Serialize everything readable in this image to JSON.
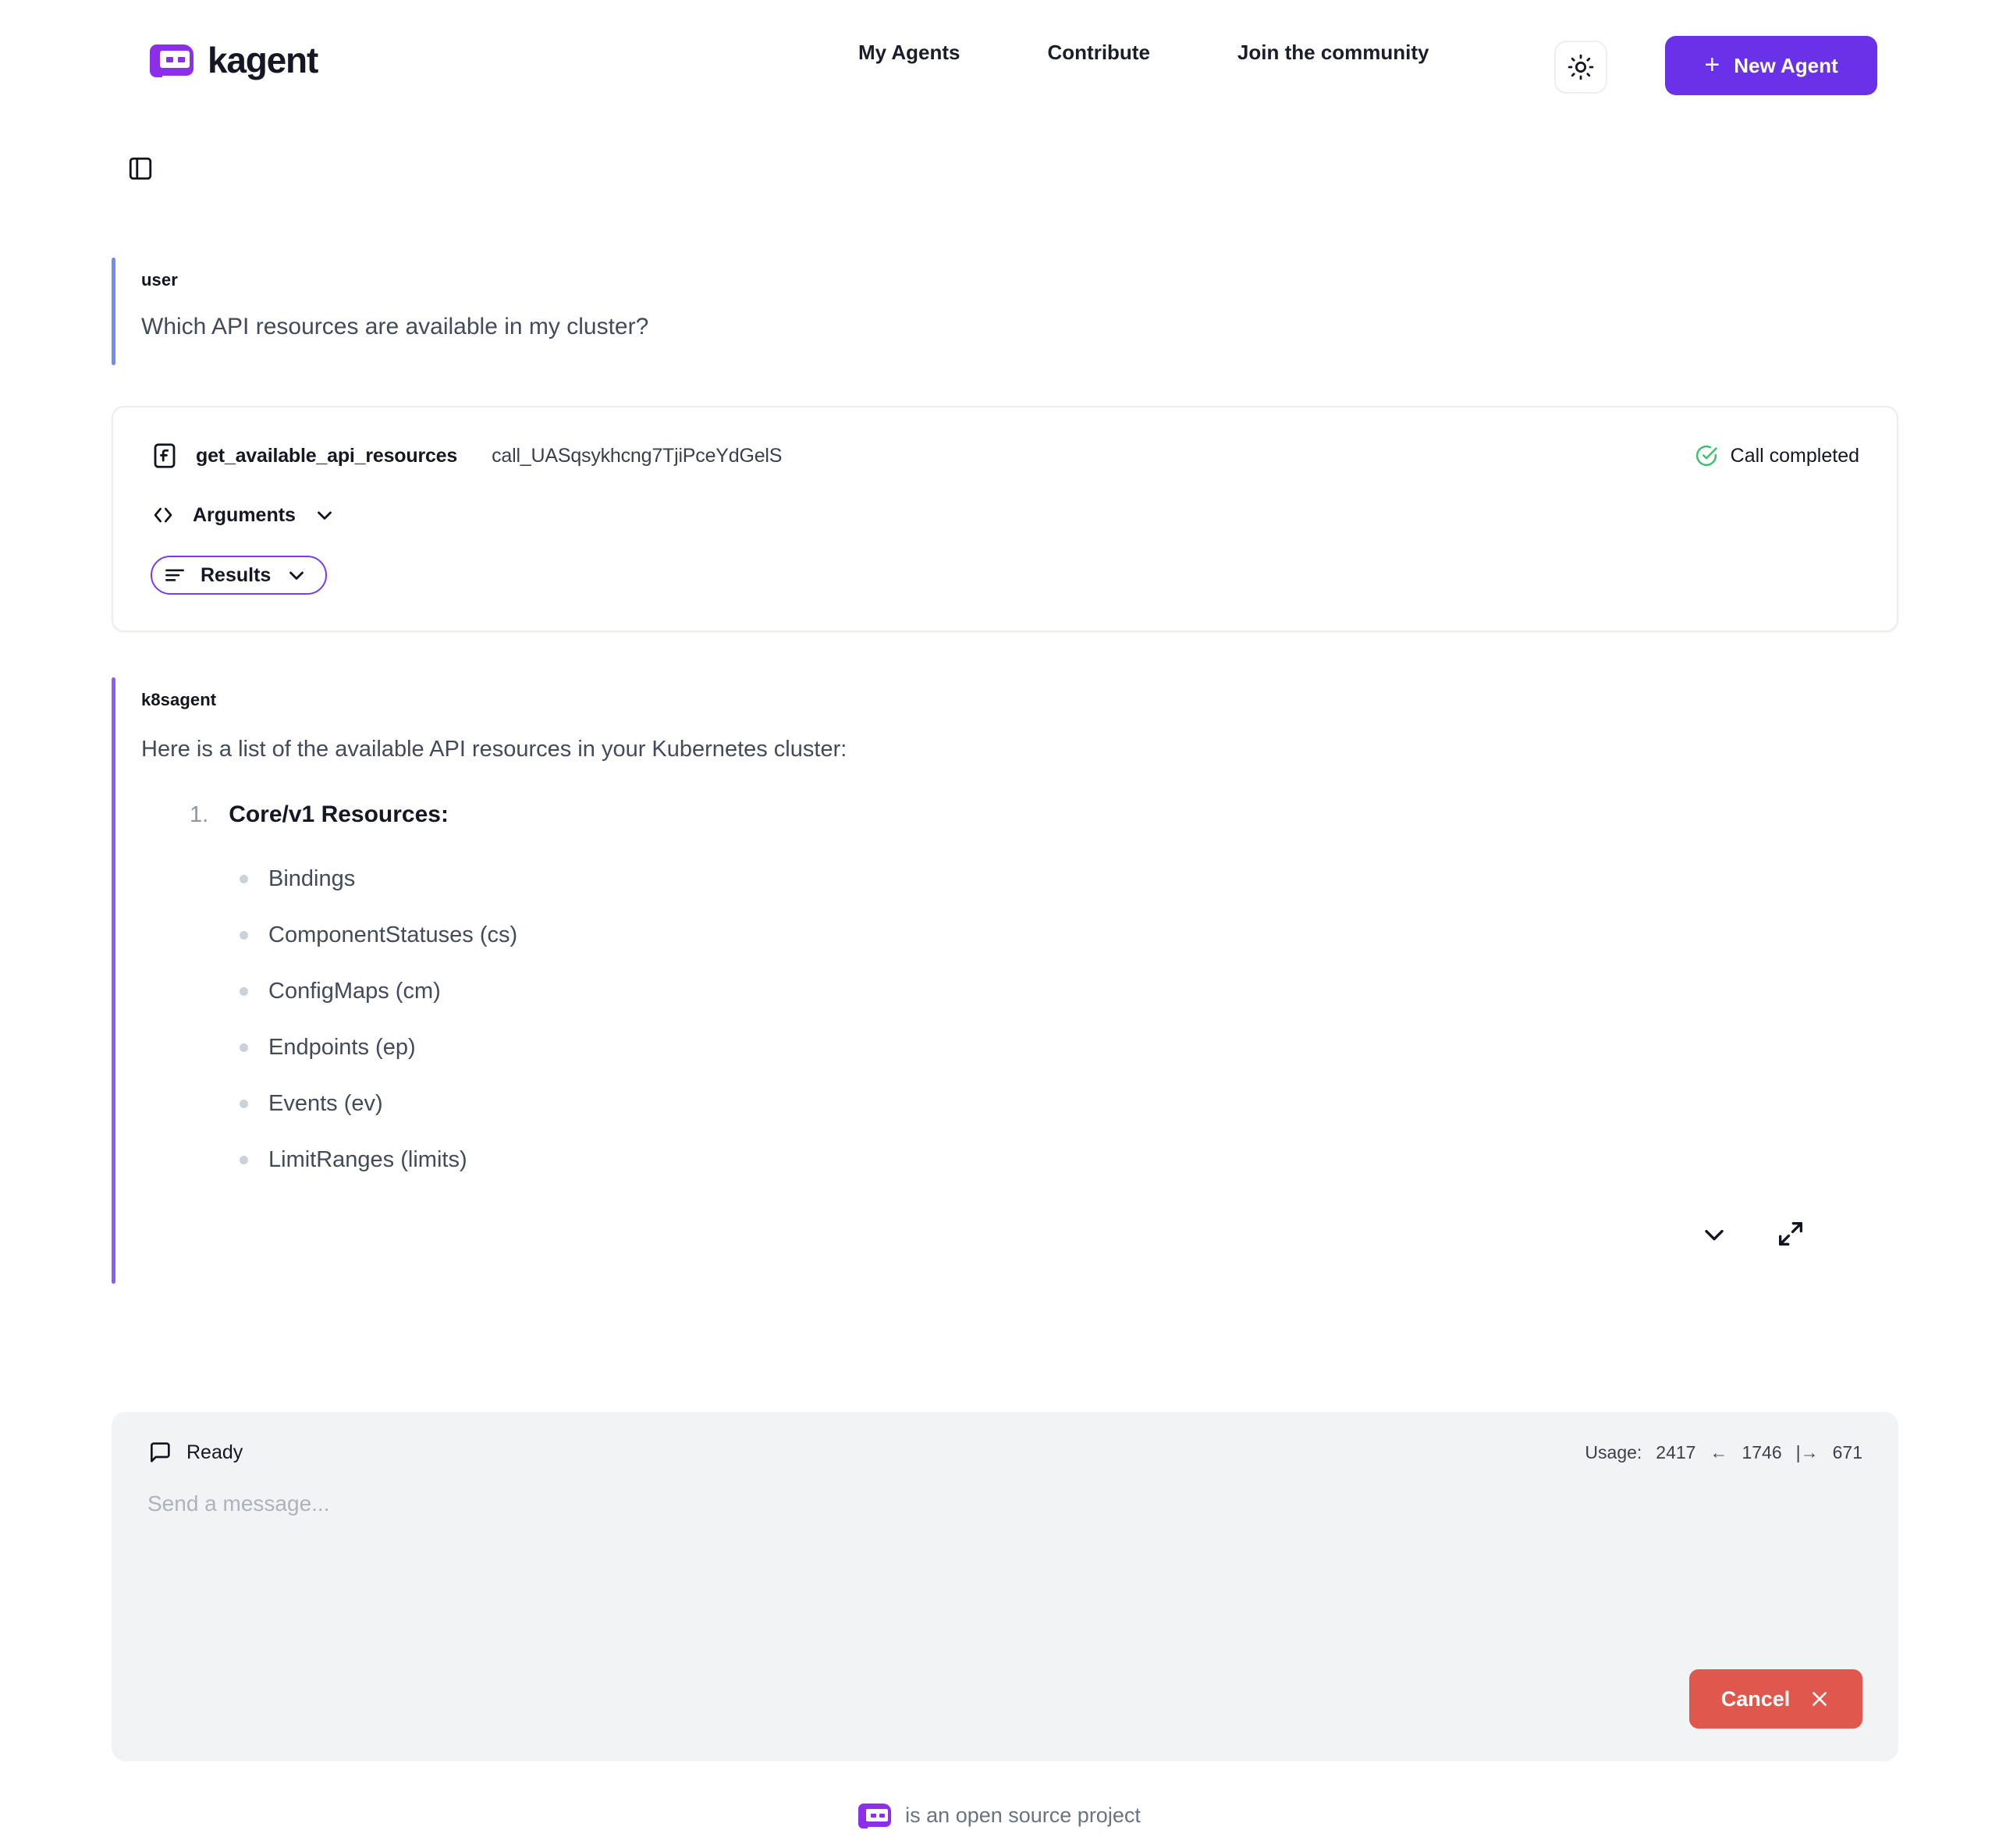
{
  "header": {
    "brand": "kagent",
    "nav": [
      {
        "label": "My Agents"
      },
      {
        "label": "Contribute"
      },
      {
        "label": "Join the community"
      }
    ],
    "theme_toggle_icon": "sun-icon",
    "new_agent_label": "New Agent",
    "plus": "+",
    "accent_color": "#6a32e8"
  },
  "sidebar_toggle_icon": "panel-left-icon",
  "conversation": {
    "user_message": {
      "role": "user",
      "text": "Which API resources are available in my cluster?",
      "accent_color": "#6e8ff0"
    },
    "tool_call": {
      "icon": "function-icon",
      "name": "get_available_api_resources",
      "call_id": "call_UASqsykhcng7TjiPceYdGelS",
      "status_icon": "check-circle-icon",
      "status": "Call completed",
      "status_color": "#3ebf6a",
      "rows": [
        {
          "icon": "code-brackets-icon",
          "label": "Arguments",
          "chevron": "chevron-down-icon",
          "focused": false
        },
        {
          "icon": "list-lines-icon",
          "label": "Results",
          "chevron": "chevron-down-icon",
          "focused": true
        }
      ],
      "focus_ring_color": "#7c3aed"
    },
    "agent_message": {
      "role": "k8sagent",
      "accent_color": "#8b5cf6",
      "intro": "Here is a list of the available API resources in your Kubernetes cluster:",
      "ordered": [
        {
          "num": "1.",
          "title": "Core/v1 Resources:"
        }
      ],
      "bullets": [
        "Bindings",
        "ComponentStatuses (cs)",
        "ConfigMaps (cm)",
        "Endpoints (ep)",
        "Events (ev)",
        "LimitRanges (limits)"
      ],
      "actions": [
        {
          "icon": "chevron-down-icon",
          "name": "collapse-message-button"
        },
        {
          "icon": "expand-arrows-icon",
          "name": "expand-message-button"
        }
      ]
    }
  },
  "input_panel": {
    "status_icon": "message-square-icon",
    "status": "Ready",
    "usage_label": "Usage:",
    "usage_total": "2417",
    "usage_input_arrow": "←",
    "usage_input": "1746",
    "usage_output_arrow": "|→",
    "usage_output": "671",
    "placeholder": "Send a message...",
    "message_value": "",
    "cancel_label": "Cancel",
    "cancel_icon": "close-icon",
    "cancel_color": "#e0574d"
  },
  "footer": {
    "text": "is an open source project",
    "logo": "kagent-mark"
  }
}
